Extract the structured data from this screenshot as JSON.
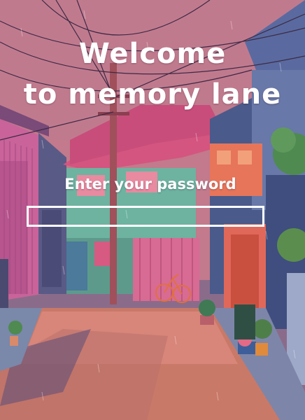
{
  "heading": {
    "line1": "Welcome",
    "line2": "to memory lane"
  },
  "password": {
    "prompt": "Enter your password",
    "value": "",
    "placeholder": ""
  },
  "colors": {
    "sky": "#c27a8c",
    "road": "#c97968",
    "accent_text": "#ffffff"
  }
}
